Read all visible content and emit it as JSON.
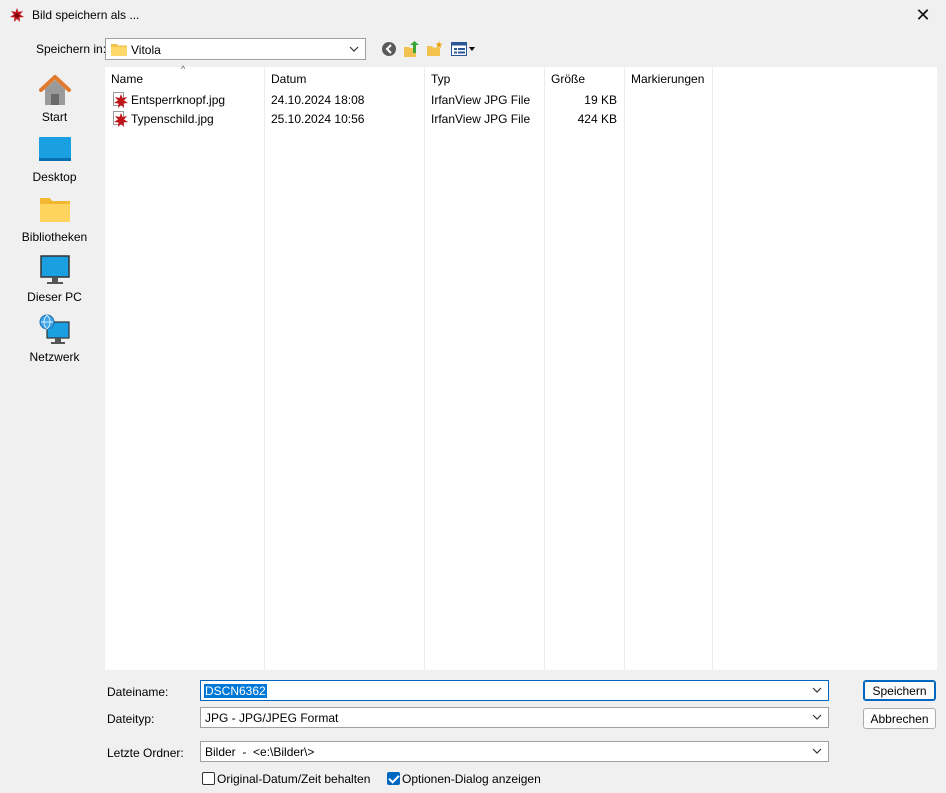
{
  "window": {
    "title": "Bild speichern als ...",
    "close_symbol": "✕"
  },
  "toolbar": {
    "save_in_label": "Speichern in:",
    "folder": "Vitola",
    "icons": [
      "back-icon",
      "up-folder-icon",
      "new-folder-icon",
      "view-menu-icon"
    ]
  },
  "places": [
    {
      "label": "Start",
      "icon": "home-icon"
    },
    {
      "label": "Desktop",
      "icon": "desktop-icon"
    },
    {
      "label": "Bibliotheken",
      "icon": "libraries-icon"
    },
    {
      "label": "Dieser PC",
      "icon": "this-pc-icon"
    },
    {
      "label": "Netzwerk",
      "icon": "network-icon"
    }
  ],
  "filelist": {
    "columns": [
      "Name",
      "Datum",
      "Typ",
      "Größe",
      "Markierungen"
    ],
    "sort_caret": "^",
    "rows": [
      {
        "name": "Entsperrknopf.jpg",
        "date": "24.10.2024 18:08",
        "type": "IrfanView JPG File",
        "size": "19 KB",
        "tags": ""
      },
      {
        "name": "Typenschild.jpg",
        "date": "25.10.2024 10:56",
        "type": "IrfanView JPG File",
        "size": "424 KB",
        "tags": ""
      }
    ]
  },
  "form": {
    "filename_label": "Dateiname:",
    "filename_value": "DSCN6362",
    "filetype_label": "Dateityp:",
    "filetype_value": "JPG - JPG/JPEG Format",
    "recent_label": "Letzte Ordner:",
    "recent_value": "Bilder  -  <e:\\Bilder\\>"
  },
  "buttons": {
    "save": "Speichern",
    "cancel": "Abbrechen"
  },
  "checkboxes": {
    "keep_date": {
      "label": "Original-Datum/Zeit behalten",
      "checked": false
    },
    "options_dialog": {
      "label": "Optionen-Dialog anzeigen",
      "checked": true
    }
  },
  "colors": {
    "accent": "#0067c0",
    "selection": "#0078d7",
    "dialog_bg": "#f0f0f0"
  }
}
